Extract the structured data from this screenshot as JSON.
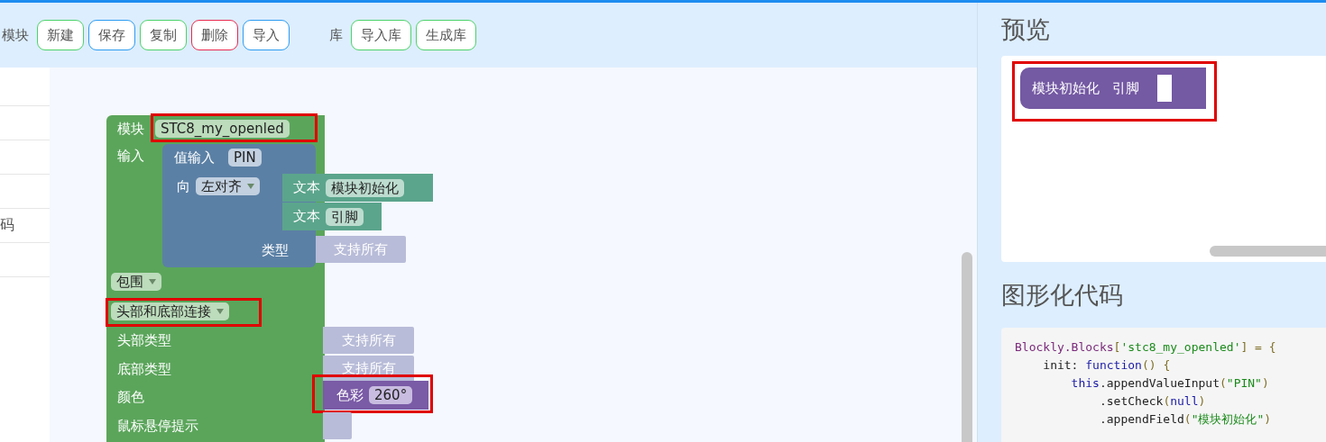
{
  "toolbar": {
    "groups": [
      {
        "label": "模块",
        "buttons": [
          {
            "label": "新建",
            "color": "#4cd26a"
          },
          {
            "label": "保存",
            "color": "#2c9bf0"
          },
          {
            "label": "复制",
            "color": "#4cd26a"
          },
          {
            "label": "删除",
            "color": "#e8294f"
          },
          {
            "label": "导入",
            "color": "#2c9bf0"
          }
        ]
      },
      {
        "label": "库",
        "buttons": [
          {
            "label": "导入库",
            "color": "#4cd26a"
          },
          {
            "label": "生成库",
            "color": "#4cd26a"
          }
        ]
      }
    ]
  },
  "side_list": {
    "items": [
      {
        "text": "码"
      }
    ]
  },
  "workspace": {
    "module_block": {
      "label": "模块",
      "name": "STC8_my_openled",
      "highlighted": true
    },
    "inputs_label": "输入",
    "value_input": {
      "label": "值输入",
      "name": "PIN",
      "align_label": "向",
      "align": "左对齐",
      "type_label": "类型",
      "type_value": "支持所有",
      "texts": [
        {
          "label": "文本",
          "value": "模块初始化"
        },
        {
          "label": "文本",
          "value": "引脚"
        }
      ]
    },
    "connections": "包围",
    "connection_mode": {
      "value": "头部和底部连接",
      "highlighted": true
    },
    "rows": [
      {
        "label": "头部类型",
        "kind": "type",
        "value": "支持所有"
      },
      {
        "label": "底部类型",
        "kind": "type",
        "value": "支持所有"
      },
      {
        "label": "颜色",
        "kind": "colour",
        "block_label": "色彩",
        "value": "260°",
        "highlighted": true
      },
      {
        "label": "鼠标悬停提示",
        "kind": "empty"
      }
    ]
  },
  "preview": {
    "title": "预览",
    "block": {
      "parts": [
        "模块初始化",
        "引脚"
      ],
      "highlighted": true
    }
  },
  "code": {
    "title": "图形化代码",
    "lines": [
      [
        {
          "t": "Blockly.Blocks",
          "kind": "object"
        },
        {
          "t": "[",
          "kind": "punct"
        },
        {
          "t": "'stc8_my_openled'",
          "kind": "string"
        },
        {
          "t": "] = {",
          "kind": "punct"
        }
      ],
      [
        {
          "t": "    init: ",
          "kind": "plain"
        },
        {
          "t": "function",
          "kind": "keyword"
        },
        {
          "t": "() {",
          "kind": "punct"
        }
      ],
      [
        {
          "t": "        this",
          "kind": "keyword"
        },
        {
          "t": ".appendValueInput",
          "kind": "plain"
        },
        {
          "t": "(",
          "kind": "punct"
        },
        {
          "t": "\"PIN\"",
          "kind": "string"
        },
        {
          "t": ")",
          "kind": "punct"
        }
      ],
      [
        {
          "t": "            .setCheck",
          "kind": "plain"
        },
        {
          "t": "(",
          "kind": "punct"
        },
        {
          "t": "null",
          "kind": "keyword"
        },
        {
          "t": ")",
          "kind": "punct"
        }
      ],
      [
        {
          "t": "            .appendField",
          "kind": "plain"
        },
        {
          "t": "(",
          "kind": "punct"
        },
        {
          "t": "\"模块初始化\"",
          "kind": "string"
        },
        {
          "t": ")",
          "kind": "punct"
        }
      ]
    ]
  }
}
